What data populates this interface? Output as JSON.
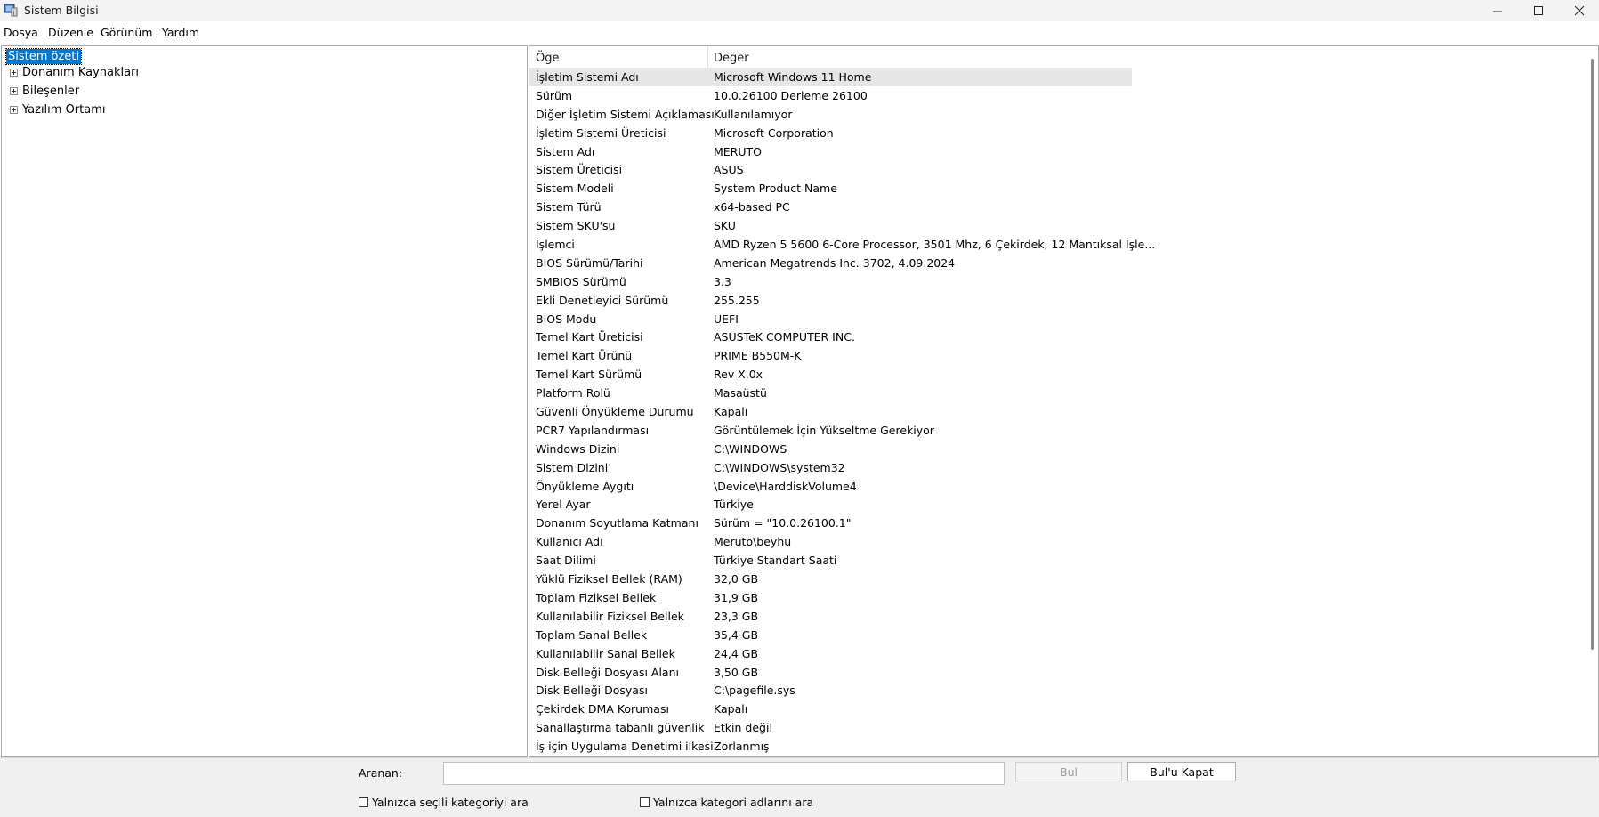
{
  "window": {
    "title": "Sistem Bilgisi",
    "controls": {
      "minimize": "—",
      "maximize": "☐",
      "close": "✕"
    }
  },
  "menu": [
    "Dosya",
    "Düzenle",
    "Görünüm",
    "Yardım"
  ],
  "tree": {
    "root": "Sistem özeti",
    "children": [
      "Donanım Kaynakları",
      "Bileşenler",
      "Yazılım Ortamı"
    ]
  },
  "details": {
    "headers": {
      "item": "Öğe",
      "value": "Değer"
    },
    "rows": [
      {
        "k": "İşletim Sistemi Adı",
        "v": "Microsoft Windows 11 Home"
      },
      {
        "k": "Sürüm",
        "v": "10.0.26100 Derleme 26100"
      },
      {
        "k": "Diğer İşletim Sistemi Açıklaması",
        "v": "Kullanılamıyor"
      },
      {
        "k": "İşletim Sistemi Üreticisi",
        "v": "Microsoft Corporation"
      },
      {
        "k": "Sistem Adı",
        "v": "MERUTO"
      },
      {
        "k": "Sistem Üreticisi",
        "v": "ASUS"
      },
      {
        "k": "Sistem Modeli",
        "v": "System Product Name"
      },
      {
        "k": "Sistem Türü",
        "v": "x64-based PC"
      },
      {
        "k": "Sistem SKU'su",
        "v": "SKU"
      },
      {
        "k": "İşlemci",
        "v": "AMD Ryzen 5 5600 6-Core Processor, 3501 Mhz, 6 Çekirdek, 12 Mantıksal İşle..."
      },
      {
        "k": "BIOS Sürümü/Tarihi",
        "v": "American Megatrends Inc. 3702, 4.09.2024"
      },
      {
        "k": "SMBIOS Sürümü",
        "v": "3.3"
      },
      {
        "k": "Ekli Denetleyici Sürümü",
        "v": "255.255"
      },
      {
        "k": "BIOS Modu",
        "v": "UEFI"
      },
      {
        "k": "Temel Kart Üreticisi",
        "v": "ASUSTeK COMPUTER INC."
      },
      {
        "k": "Temel Kart Ürünü",
        "v": "PRIME B550M-K"
      },
      {
        "k": "Temel Kart Sürümü",
        "v": "Rev X.0x"
      },
      {
        "k": "Platform Rolü",
        "v": "Masaüstü"
      },
      {
        "k": "Güvenli Önyükleme Durumu",
        "v": "Kapalı"
      },
      {
        "k": "PCR7 Yapılandırması",
        "v": "Görüntülemek İçin Yükseltme Gerekiyor"
      },
      {
        "k": "Windows Dizini",
        "v": "C:\\WINDOWS"
      },
      {
        "k": "Sistem Dizini",
        "v": "C:\\WINDOWS\\system32"
      },
      {
        "k": "Önyükleme Aygıtı",
        "v": "\\Device\\HarddiskVolume4"
      },
      {
        "k": "Yerel Ayar",
        "v": "Türkiye"
      },
      {
        "k": "Donanım Soyutlama Katmanı",
        "v": "Sürüm = \"10.0.26100.1\""
      },
      {
        "k": "Kullanıcı Adı",
        "v": "Meruto\\beyhu"
      },
      {
        "k": "Saat Dilimi",
        "v": "Türkiye Standart Saati"
      },
      {
        "k": "Yüklü Fiziksel Bellek (RAM)",
        "v": "32,0 GB"
      },
      {
        "k": "Toplam Fiziksel Bellek",
        "v": "31,9 GB"
      },
      {
        "k": "Kullanılabilir Fiziksel Bellek",
        "v": "23,3 GB"
      },
      {
        "k": "Toplam Sanal Bellek",
        "v": "35,4 GB"
      },
      {
        "k": "Kullanılabilir Sanal Bellek",
        "v": "24,4 GB"
      },
      {
        "k": "Disk Belleği Dosyası Alanı",
        "v": "3,50 GB"
      },
      {
        "k": "Disk Belleği Dosyası",
        "v": "C:\\pagefile.sys"
      },
      {
        "k": "Çekirdek DMA Koruması",
        "v": "Kapalı"
      },
      {
        "k": "Sanallaştırma tabanlı güvenlik",
        "v": "Etkin değil"
      },
      {
        "k": "İş için Uygulama Denetimi ilkesi",
        "v": "Zorlanmış"
      }
    ]
  },
  "search": {
    "label": "Aranan:",
    "value": "",
    "find_button": "Bul",
    "close_find_button": "Bul'u Kapat",
    "only_selected_category": "Yalnızca seçili kategoriyi ara",
    "only_category_names": "Yalnızca kategori adlarını ara"
  }
}
